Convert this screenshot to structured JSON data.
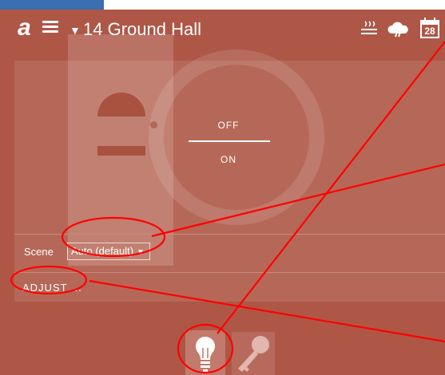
{
  "header": {
    "logo": "a",
    "room_caret": "▼",
    "room_title": "14 Ground Hall",
    "calendar_day": "28",
    "icons": [
      "menu-icon",
      "heat-waves-icon",
      "weather-cloud-icon",
      "calendar-icon"
    ]
  },
  "control": {
    "off_label": "OFF",
    "on_label": "ON"
  },
  "scene": {
    "label": "Scene",
    "value": "Auto (default)",
    "caret": "▼"
  },
  "adjust": {
    "label": "ADJUST ..."
  },
  "bottom_tabs": [
    {
      "icon": "lightbulb-icon",
      "active": true
    },
    {
      "icon": "key-icon",
      "active": false
    }
  ],
  "colors": {
    "background": "#ae5747",
    "panel": "#b66858",
    "annotation": "#ff0000",
    "top_tab": "#3a6fb2"
  }
}
